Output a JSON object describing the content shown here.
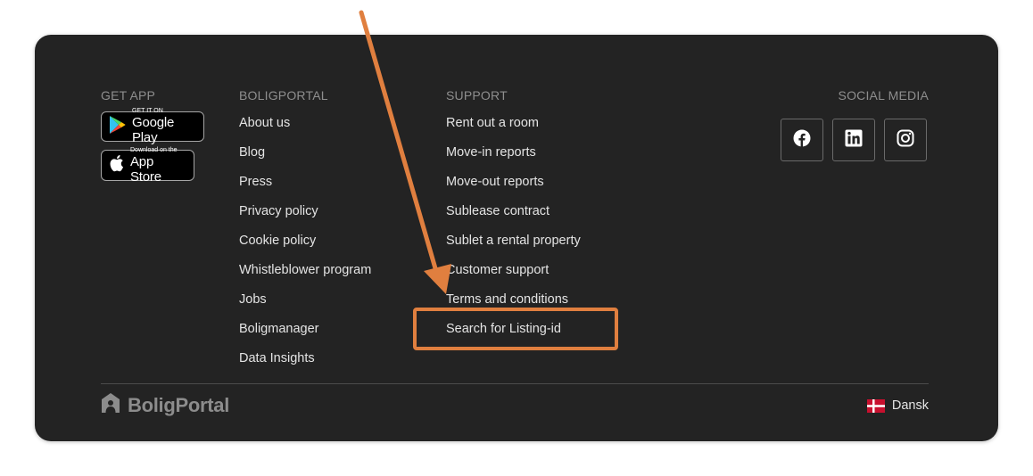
{
  "footer": {
    "get_app": {
      "title": "GET APP",
      "google_play": {
        "small": "GET IT ON",
        "big": "Google Play"
      },
      "app_store": {
        "small": "Download on the",
        "big": "App Store"
      }
    },
    "boligportal": {
      "title": "BOLIGPORTAL",
      "links": [
        "About us",
        "Blog",
        "Press",
        "Privacy policy",
        "Cookie policy",
        "Whistleblower program",
        "Jobs",
        "Boligmanager",
        "Data Insights"
      ]
    },
    "support": {
      "title": "SUPPORT",
      "links": [
        "Rent out a room",
        "Move-in reports",
        "Move-out reports",
        "Sublease contract",
        "Sublet a rental property",
        "Customer support",
        "Terms and conditions",
        "Search for Listing-id"
      ]
    },
    "social": {
      "title": "SOCIAL MEDIA",
      "icons": [
        "facebook-icon",
        "linkedin-icon",
        "instagram-icon"
      ]
    },
    "brand": "BoligPortal",
    "language": "Dansk"
  },
  "colors": {
    "footer_bg": "#232323",
    "annotation": "#e07f3f",
    "link_text": "#e4e4e4",
    "muted_text": "#8e8e8e"
  }
}
